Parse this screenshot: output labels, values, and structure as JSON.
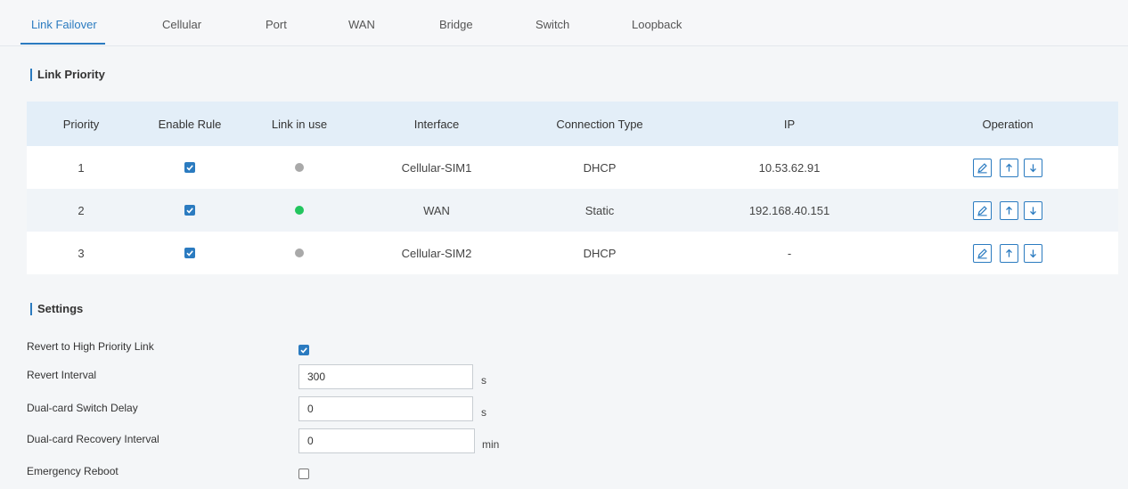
{
  "tabs": [
    {
      "label": "Link Failover",
      "active": true
    },
    {
      "label": "Cellular",
      "active": false
    },
    {
      "label": "Port",
      "active": false
    },
    {
      "label": "WAN",
      "active": false
    },
    {
      "label": "Bridge",
      "active": false
    },
    {
      "label": "Switch",
      "active": false
    },
    {
      "label": "Loopback",
      "active": false
    }
  ],
  "link_priority": {
    "title": "Link Priority",
    "columns": [
      "Priority",
      "Enable Rule",
      "Link in use",
      "Interface",
      "Connection Type",
      "IP",
      "Operation"
    ],
    "rows": [
      {
        "priority": "1",
        "enabled": true,
        "link_status": "grey",
        "interface": "Cellular-SIM1",
        "connection_type": "DHCP",
        "ip": "10.53.62.91"
      },
      {
        "priority": "2",
        "enabled": true,
        "link_status": "green",
        "interface": "WAN",
        "connection_type": "Static",
        "ip": "192.168.40.151"
      },
      {
        "priority": "3",
        "enabled": true,
        "link_status": "grey",
        "interface": "Cellular-SIM2",
        "connection_type": "DHCP",
        "ip": "-"
      }
    ]
  },
  "settings": {
    "title": "Settings",
    "revert_high_priority": {
      "label": "Revert to High Priority Link",
      "checked": true
    },
    "revert_interval": {
      "label": "Revert Interval",
      "value": "300",
      "unit": "s"
    },
    "dual_card_switch_delay": {
      "label": "Dual-card Switch Delay",
      "value": "0",
      "unit": "s"
    },
    "dual_card_recovery_interval": {
      "label": "Dual-card Recovery Interval",
      "value": "0",
      "unit": "min"
    },
    "emergency_reboot": {
      "label": "Emergency Reboot",
      "checked": false
    }
  },
  "colors": {
    "accent": "#2b7bc0",
    "status_green": "#22c55e",
    "status_grey": "#a9a9a9",
    "header_bg": "#e3eef8"
  },
  "icons": {
    "edit": "edit-icon",
    "move_up": "arrow-up-icon",
    "move_down": "arrow-down-icon",
    "check": "checkmark-icon"
  }
}
